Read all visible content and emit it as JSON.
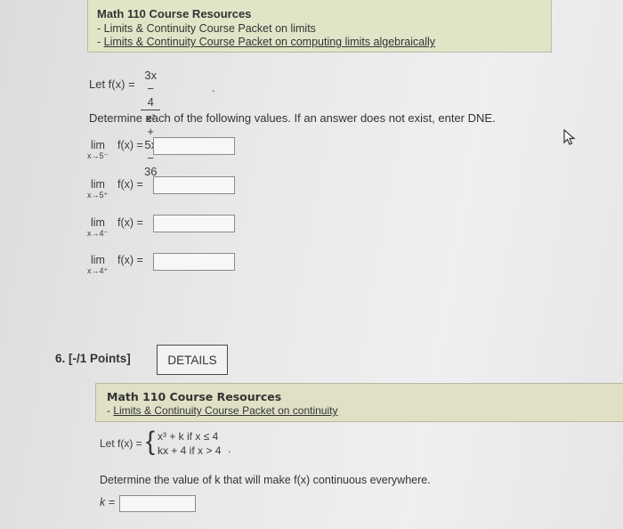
{
  "problem5": {
    "resources_title": "Math 110 Course Resources",
    "link1_prefix": "- ",
    "link1": "Limits & Continuity Course Packet on limits",
    "link2_prefix": "- ",
    "link2": "Limits & Continuity Course Packet on computing limits algebraically",
    "let_label": "Let f(x) =",
    "numerator": "3x − 4",
    "denominator": "x² + 5x − 36",
    "trailing": ".",
    "instructions": "Determine each of the following values. If an answer does not exist, enter DNE.",
    "limits": [
      {
        "lim": "lim",
        "sub": "x→5⁻",
        "expr": "f(x) =",
        "answer": ""
      },
      {
        "lim": "lim",
        "sub": "x→5⁺",
        "expr": "f(x) =",
        "answer": ""
      },
      {
        "lim": "lim",
        "sub": "x→4⁻",
        "expr": "f(x) =",
        "answer": ""
      },
      {
        "lim": "lim",
        "sub": "x→4⁺",
        "expr": "f(x) =",
        "answer": ""
      }
    ]
  },
  "problem6": {
    "header": "6.  [-/1 Points]",
    "details_button": "DETAILS",
    "resources_title": "Math 110 Course Resources",
    "link_prefix": "- ",
    "link": "Limits & Continuity Course Packet on continuity",
    "let_label": "Let f(x) =",
    "piece1": "x³ + k   if x ≤ 4",
    "piece2": "kx + 4   if x > 4",
    "trailing": ".",
    "instructions": "Determine the value of k that will make f(x) continuous everywhere.",
    "k_label": "k =",
    "k_answer": ""
  }
}
